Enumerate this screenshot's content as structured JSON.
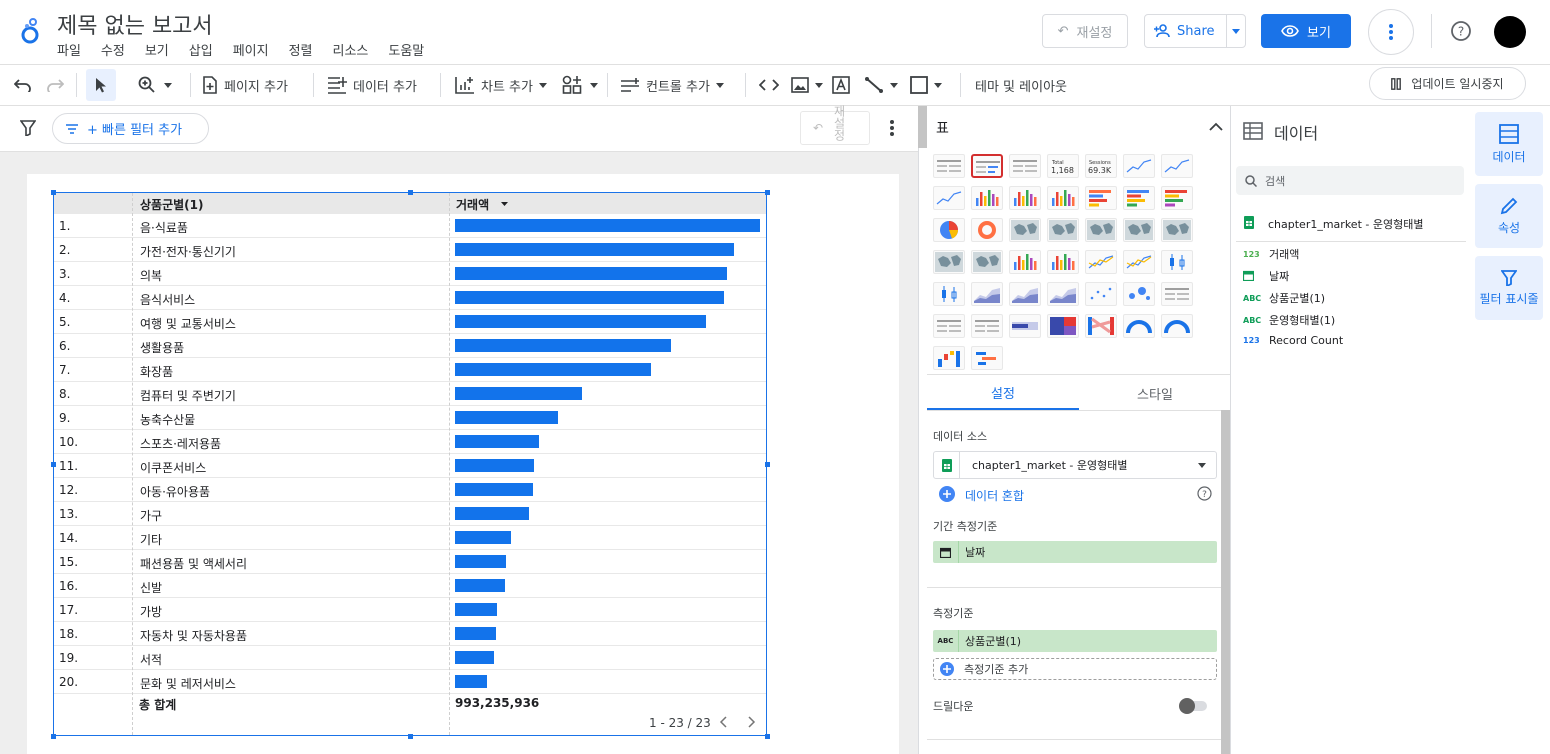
{
  "header": {
    "title": "제목 없는 보고서",
    "menus": [
      "파일",
      "수정",
      "보기",
      "삽입",
      "페이지",
      "정렬",
      "리소스",
      "도움말"
    ],
    "reset_label": "재설정",
    "share_label": "Share",
    "view_label": "보기"
  },
  "toolbar": {
    "add_page": "페이지 추가",
    "add_data": "데이터 추가",
    "add_chart": "차트 추가",
    "add_control": "컨트롤 추가",
    "theme_layout": "테마 및 레이아웃",
    "pause_updates": "업데이트 일시중지"
  },
  "filterbar": {
    "quick_filter": "+ 빠른 필터 추가",
    "reset": "재설정"
  },
  "table": {
    "col_dim": "상품군별(1)",
    "col_metric": "거래액",
    "rows": [
      {
        "n": "1.",
        "cat": "음·식료품",
        "value": 1.0
      },
      {
        "n": "2.",
        "cat": "가전·전자·통신기기",
        "value": 0.914
      },
      {
        "n": "3.",
        "cat": "의복",
        "value": 0.891
      },
      {
        "n": "4.",
        "cat": "음식서비스",
        "value": 0.881
      },
      {
        "n": "5.",
        "cat": "여행 및 교통서비스",
        "value": 0.824
      },
      {
        "n": "6.",
        "cat": "생활용품",
        "value": 0.709
      },
      {
        "n": "7.",
        "cat": "화장품",
        "value": 0.643
      },
      {
        "n": "8.",
        "cat": "컴퓨터 및 주변기기",
        "value": 0.418
      },
      {
        "n": "9.",
        "cat": "농축수산물",
        "value": 0.337
      },
      {
        "n": "10.",
        "cat": "스포츠·레저용품",
        "value": 0.277
      },
      {
        "n": "11.",
        "cat": "이쿠폰서비스",
        "value": 0.258
      },
      {
        "n": "12.",
        "cat": "아동·유아용품",
        "value": 0.255
      },
      {
        "n": "13.",
        "cat": "가구",
        "value": 0.242
      },
      {
        "n": "14.",
        "cat": "기타",
        "value": 0.183
      },
      {
        "n": "15.",
        "cat": "패션용품 및 액세서리",
        "value": 0.167
      },
      {
        "n": "16.",
        "cat": "신발",
        "value": 0.163
      },
      {
        "n": "17.",
        "cat": "가방",
        "value": 0.137
      },
      {
        "n": "18.",
        "cat": "자동차 및 자동차용품",
        "value": 0.134
      },
      {
        "n": "19.",
        "cat": "서적",
        "value": 0.128
      },
      {
        "n": "20.",
        "cat": "문화 및 레저서비스",
        "value": 0.106
      }
    ],
    "total_label": "총 합계",
    "total_value": "993,235,936",
    "pagination": "1 - 23 / 23"
  },
  "chart_panel": {
    "title": "표",
    "tiles_total": {
      "t1": "Total",
      "t2": "1,168",
      "s1": "Sessions",
      "s2": "69.3K"
    },
    "tab_setup": "설정",
    "tab_style": "스타일",
    "data_source_label": "데이터 소스",
    "data_source_value": "chapter1_market - 운영형태별",
    "blend_label": "데이터 혼합",
    "date_range_label": "기간 측정기준",
    "date_range_value": "날짜",
    "dimension_label": "측정기준",
    "dimension_value": "상품군별(1)",
    "add_dimension": "측정기준 추가",
    "drilldown_label": "드릴다운",
    "abc": "ABC"
  },
  "data_panel": {
    "title": "데이터",
    "search_placeholder": "검색",
    "source_name": "chapter1_market - 운영형태별",
    "fields": [
      {
        "type": "123",
        "name": "거래액"
      },
      {
        "type": "cal",
        "name": "날짜"
      },
      {
        "type": "ABC",
        "name": "상품군별(1)"
      },
      {
        "type": "ABC",
        "name": "운영형태별(1)"
      },
      {
        "type": "123",
        "name": "Record Count"
      }
    ]
  },
  "rail": {
    "data": "데이터",
    "properties": "속성",
    "filters": "필터 표시줄"
  },
  "colors": {
    "accent": "#1a73e8",
    "bar": "#1273eb",
    "chip": "#c8e6c9"
  }
}
